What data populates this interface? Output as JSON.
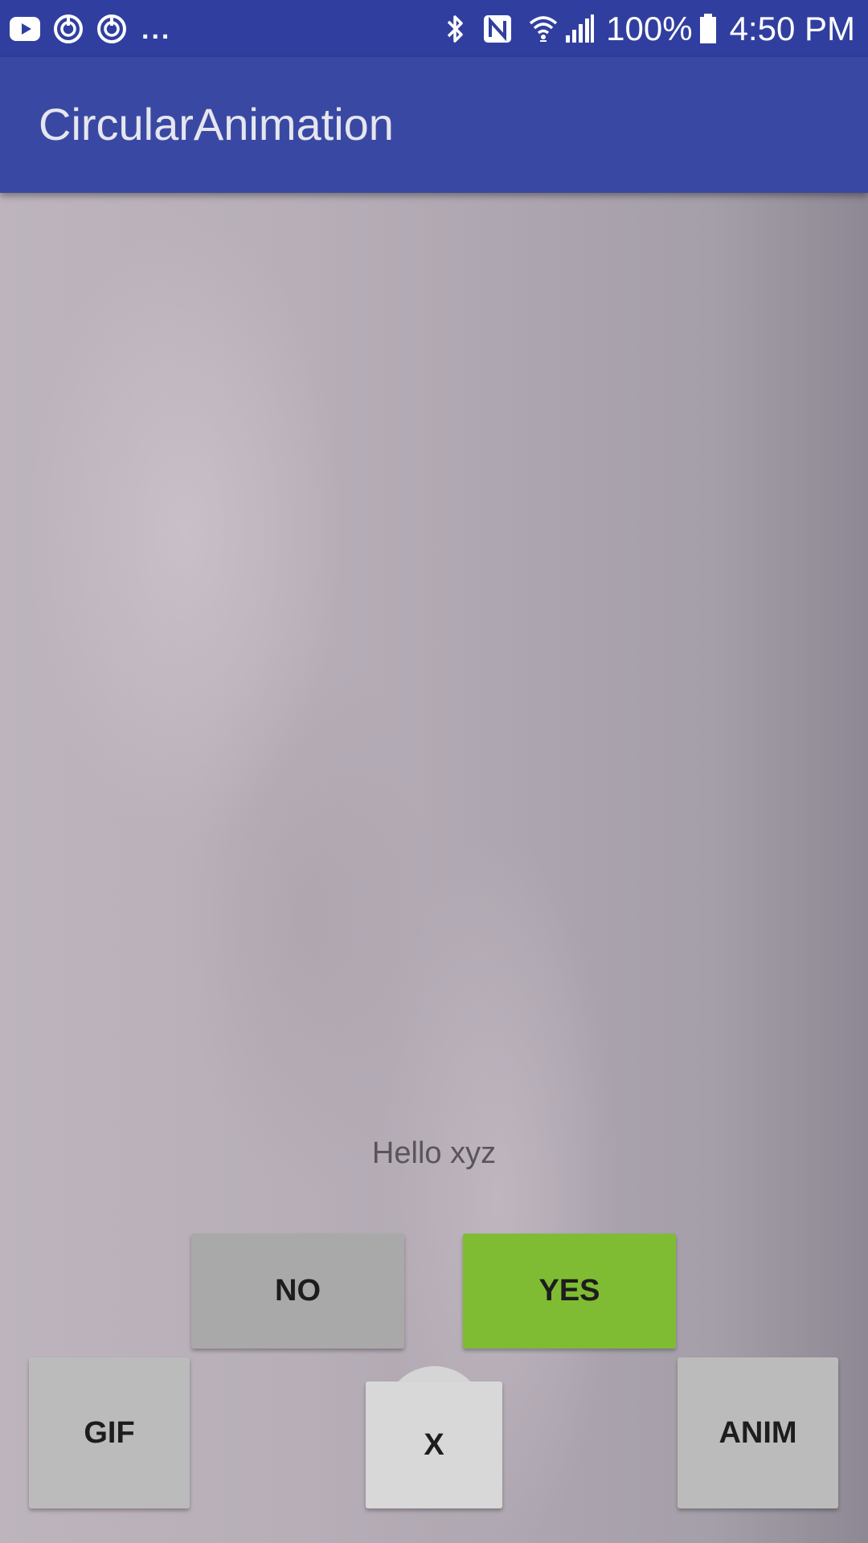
{
  "status_bar": {
    "battery": "100%",
    "time": "4:50 PM",
    "left_icons": [
      "youtube-icon",
      "sync-icon",
      "sync-icon",
      "more-notifications-icon"
    ],
    "right_icons": [
      "bluetooth-icon",
      "nfc-icon",
      "wifi-icon",
      "signal-icon",
      "battery-icon"
    ],
    "more": "..."
  },
  "app_bar": {
    "title": "CircularAnimation"
  },
  "main": {
    "hello_text": "Hello xyz",
    "buttons": {
      "no": "NO",
      "yes": "YES",
      "gif": "GIF",
      "x": "X",
      "anim": "ANIM"
    }
  },
  "colors": {
    "status_bar": "#303f9f",
    "app_bar": "#3949a3",
    "yes_button": "#80bc33",
    "no_button": "#aaa9aa",
    "side_buttons": "#bbbbbb",
    "x_button": "#d8d8d9"
  }
}
